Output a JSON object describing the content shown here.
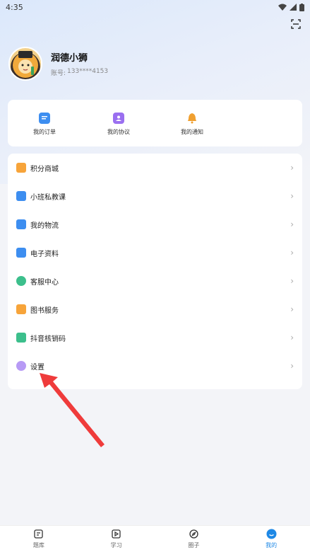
{
  "status_bar": {
    "time": "4:35"
  },
  "profile": {
    "name": "润德小狮",
    "account_label": "账号:",
    "account_value": "133****4153"
  },
  "quick_actions": [
    {
      "label": "我的订单",
      "icon": "order-icon",
      "color": "#3d8ef0"
    },
    {
      "label": "我的协议",
      "icon": "agreement-icon",
      "color": "#9a6ff0"
    },
    {
      "label": "我的通知",
      "icon": "bell-icon",
      "color": "#f0a030"
    }
  ],
  "menu": [
    {
      "label": "积分商城",
      "icon": "points-mall-icon",
      "color": "#f7a43a"
    },
    {
      "label": "小班私教课",
      "icon": "private-class-icon",
      "color": "#3d8ef0"
    },
    {
      "label": "我的物流",
      "icon": "logistics-icon",
      "color": "#3d8ef0"
    },
    {
      "label": "电子资料",
      "icon": "e-material-icon",
      "color": "#3d8ef0"
    },
    {
      "label": "客服中心",
      "icon": "customer-service-icon",
      "color": "#3cbf8c"
    },
    {
      "label": "图书服务",
      "icon": "book-service-icon",
      "color": "#f7a43a"
    },
    {
      "label": "抖音核销码",
      "icon": "douyin-code-icon",
      "color": "#3cbf8c"
    },
    {
      "label": "设置",
      "icon": "settings-icon",
      "color": "#9a6ff0"
    }
  ],
  "bottom_nav": [
    {
      "label": "题库",
      "icon": "question-bank-icon",
      "active": false
    },
    {
      "label": "学习",
      "icon": "study-play-icon",
      "active": false
    },
    {
      "label": "圈子",
      "icon": "compass-icon",
      "active": false
    },
    {
      "label": "我的",
      "icon": "profile-icon",
      "active": true
    }
  ],
  "accent_color": "#1e88e5",
  "annotation_color": "#ef3b3b"
}
